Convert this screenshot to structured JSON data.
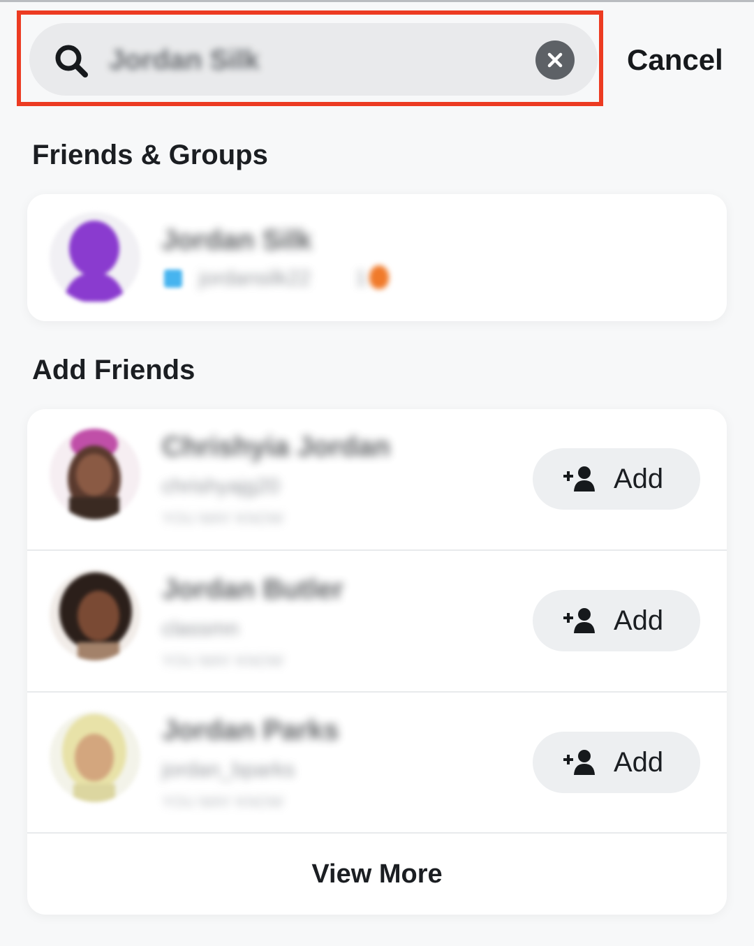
{
  "search": {
    "value": "Jordan Silk",
    "cancel_label": "Cancel"
  },
  "sections": {
    "friends_groups_title": "Friends & Groups",
    "add_friends_title": "Add Friends"
  },
  "friend": {
    "name": "Jordan Silk",
    "username": "jordansilk22",
    "streak": "1"
  },
  "suggestions": [
    {
      "name": "Chrishyia Jordan",
      "username": "chrishyajg20",
      "subtitle": "YOU MAY KNOW",
      "add_label": "Add"
    },
    {
      "name": "Jordan Butler",
      "username": "classmn",
      "subtitle": "YOU MAY KNOW",
      "add_label": "Add"
    },
    {
      "name": "Jordan Parks",
      "username": "jordan_bparks",
      "subtitle": "YOU MAY KNOW",
      "add_label": "Add"
    }
  ],
  "view_more_label": "View More",
  "colors": {
    "highlight": "#ec3b22",
    "friend_avatar": "#8a3bcf",
    "background": "#f7f8f9"
  }
}
